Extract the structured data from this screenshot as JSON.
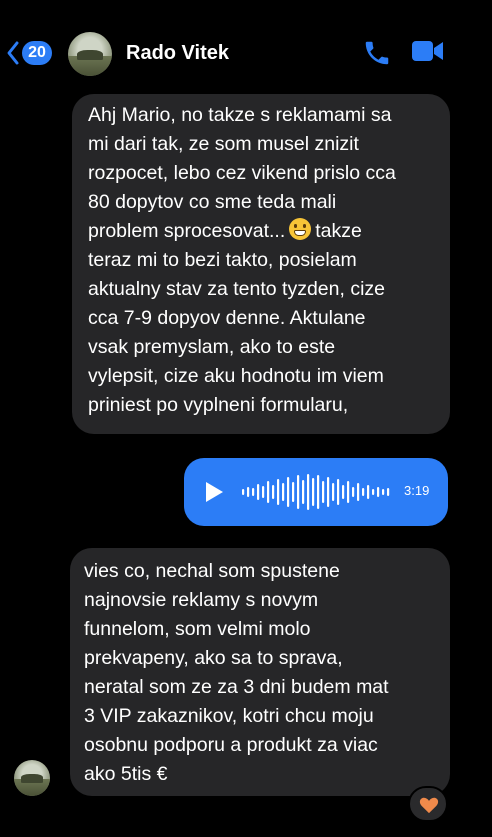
{
  "header": {
    "unread_count": "20",
    "contact_name": "Rado Vitek",
    "icons": [
      "back-chevron-icon",
      "avatar-photo",
      "phone-icon",
      "video-camera-icon"
    ]
  },
  "messages": {
    "first_text_before_emoji": "Ahj Mario, no takze s reklamami sa\nmi dari tak, ze som musel znizit\nrozpocet, lebo cez vikend prislo cca\n80 dopytov co sme teda mali\nproblem sprocesovat...",
    "first_text_after_emoji": "takze\nteraz mi to bezi takto, posielam\naktualny stav za tento tyzden, cize\ncca 7-9 dopyov denne. Aktulane\nvsak premyslam, ako to este\nvylepsit, cize aku hodnotu im viem\npriniest po vyplneni formularu,",
    "voice_duration": "3:19",
    "second_text": "vies co, nechal som spustene\nnajnovsie reklamy s novym\nfunnelom, som velmi molo\nprekvapeny, ako sa to sprava,\nneratal som ze za 3 dni budem mat\n3 VIP zakaznikov, kotri chcu moju\nosobnu podporu a produkt za viac\nako 5tis €"
  },
  "reaction": {
    "icon": "heart-icon",
    "color": "#f08a4b"
  },
  "colors": {
    "accent": "#2c7df6",
    "incoming_bubble": "#262628"
  }
}
